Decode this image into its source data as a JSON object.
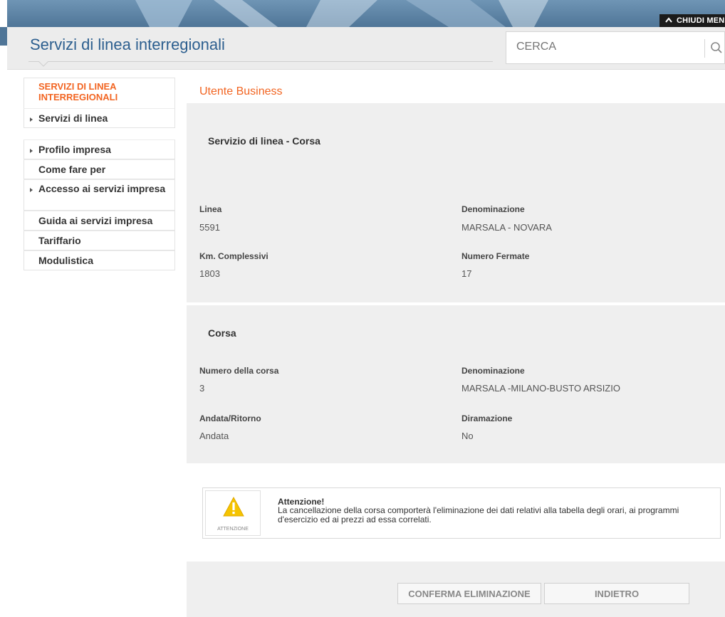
{
  "banner": {
    "close_menu": "CHIUDI MENU"
  },
  "header": {
    "title": "Servizi di linea interregionali",
    "search": {
      "placeholder": "CERCA"
    }
  },
  "sidebar": {
    "heading": "SERVIZI DI LINEA INTERREGIONALI",
    "group1": [
      {
        "label": "Servizi di linea",
        "arrow": true
      }
    ],
    "group2": [
      {
        "label": "Profilo impresa",
        "arrow": true
      },
      {
        "label": "Come fare per",
        "arrow": false
      },
      {
        "label": "Accesso ai servizi impresa",
        "arrow": true
      },
      {
        "label": "Guida ai servizi impresa",
        "arrow": false
      },
      {
        "label": "Tariffario",
        "arrow": false
      },
      {
        "label": "Modulistica",
        "arrow": false
      }
    ]
  },
  "main": {
    "section_title": "Utente Business",
    "service": {
      "title": "Servizio di linea - Corsa",
      "linea_label": "Linea",
      "linea_value": "5591",
      "denominazione_label": "Denominazione",
      "denominazione_value": "MARSALA - NOVARA",
      "km_label": "Km. Complessivi",
      "km_value": "1803",
      "fermate_label": "Numero Fermate",
      "fermate_value": "17"
    },
    "corsa": {
      "title": "Corsa",
      "numero_label": "Numero della corsa",
      "numero_value": "3",
      "denominazione_label": "Denominazione",
      "denominazione_value": "MARSALA -MILANO-BUSTO ARSIZIO",
      "andata_label": "Andata/Ritorno",
      "andata_value": "Andata",
      "diramazione_label": "Diramazione",
      "diramazione_value": "No"
    },
    "warning": {
      "icon_caption": "ATTENZIONE",
      "title": "Attenzione!",
      "text": "La cancellazione della corsa comporterà l'eliminazione dei dati relativi alla tabella degli orari, ai programmi d'esercizio ed ai prezzi ad essa correlati."
    },
    "buttons": {
      "confirm": "CONFERMA ELIMINAZIONE",
      "back": "INDIETRO"
    }
  },
  "colors": {
    "accent": "#f26522",
    "title_blue": "#2d5f8f",
    "warning_yellow": "#f5c400"
  },
  "icons": {
    "search": "search-icon",
    "warning": "warning-icon",
    "close_menu": "chevron-up-icon"
  }
}
